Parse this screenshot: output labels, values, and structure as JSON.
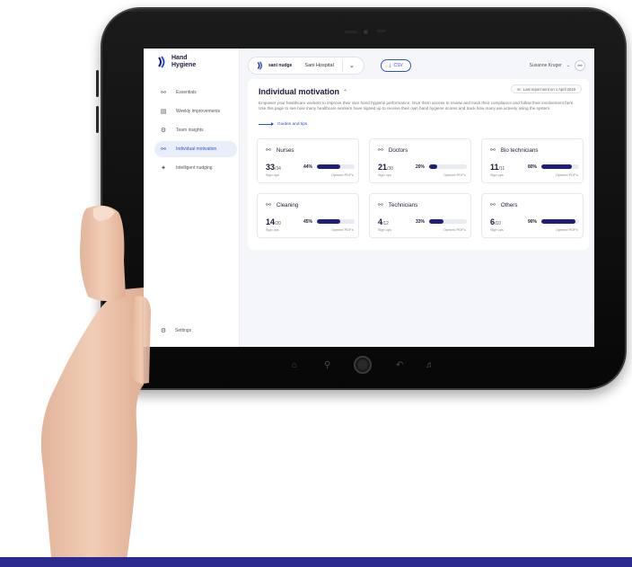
{
  "app": {
    "brand_line1": "Hand",
    "brand_line2": "Hygiene"
  },
  "sidebar": {
    "items": [
      {
        "label": "Essentials",
        "icon": "person-icon"
      },
      {
        "label": "Weekly improvements",
        "icon": "chart-icon"
      },
      {
        "label": "Team insights",
        "icon": "team-icon"
      },
      {
        "label": "Individual motivation",
        "icon": "person-icon",
        "active": true
      },
      {
        "label": "Intelligent nudging",
        "icon": "nudge-icon"
      }
    ],
    "settings_label": "Settings"
  },
  "topbar": {
    "org_logo": "sani nudge",
    "org_name": "Sani Hospital",
    "csv_label": "CSV",
    "user_name": "Susanne Kruger"
  },
  "main": {
    "title": "Individual motivation",
    "report_badge": "Last report sent on 1 April 2019",
    "description": "Empower your healthcare workers to improve their own hand hygiene performance. Give them access to review and track their compliance and follow their involvement here. Use this page to see how many healthcare workers have signed up to receive their own hand hygiene scores and track how many are actively using the system.",
    "guides_label": "Guides and tips",
    "signups_label": "Sign ups",
    "opened_label": "Opened PDF's",
    "cards": [
      {
        "name": "Nurses",
        "count": "33",
        "total": "/34",
        "pct": "44%",
        "fill": 0.62
      },
      {
        "name": "Doctors",
        "count": "21",
        "total": "/30",
        "pct": "20%",
        "fill": 0.22
      },
      {
        "name": "Bio technicians",
        "count": "11",
        "total": "/11",
        "pct": "80%",
        "fill": 0.8
      },
      {
        "name": "Cleaning",
        "count": "14",
        "total": "/20",
        "pct": "45%",
        "fill": 0.62
      },
      {
        "name": "Technicians",
        "count": "4",
        "total": "/12",
        "pct": "33%",
        "fill": 0.38
      },
      {
        "name": "Others",
        "count": "6",
        "total": "/10",
        "pct": "90%",
        "fill": 0.9
      }
    ]
  },
  "colors": {
    "accent": "#2e4fd6",
    "bar": "#1f1f7a",
    "band": "#2b2b8f"
  }
}
